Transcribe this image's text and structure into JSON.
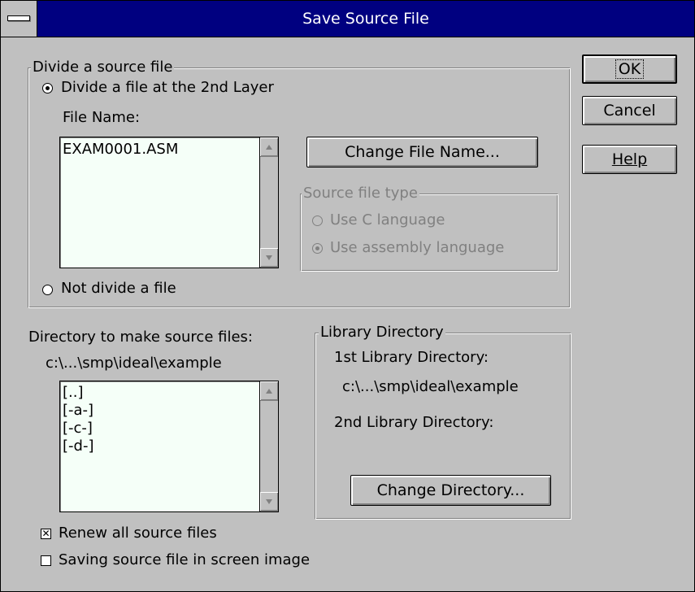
{
  "window": {
    "title": "Save Source File"
  },
  "buttons": {
    "ok": "OK",
    "cancel": "Cancel",
    "help": "Help",
    "change_file_name": "Change File Name...",
    "change_directory": "Change Directory..."
  },
  "divide_group": {
    "legend": "Divide a source file",
    "divide_radio_label": "Divide a file at the 2nd Layer",
    "divide_radio_selected": true,
    "file_name_label": "File Name:",
    "file_list": [
      "EXAM0001.ASM"
    ],
    "not_divide_label": "Not divide a file",
    "not_divide_selected": false
  },
  "source_type_group": {
    "legend": "Source file type",
    "use_c_label": "Use C language",
    "use_asm_label": "Use assembly language",
    "selected": "assembly",
    "enabled": false
  },
  "directory": {
    "label": "Directory to make source files:",
    "path": "c:\\...\\smp\\ideal\\example",
    "items": [
      "[..]",
      "[-a-]",
      "[-c-]",
      "[-d-]"
    ]
  },
  "library_group": {
    "legend": "Library Directory",
    "first_label": "1st Library Directory:",
    "first_path": "c:\\...\\smp\\ideal\\example",
    "second_label": "2nd Library Directory:",
    "second_path": ""
  },
  "options": {
    "renew_label": "Renew all source files",
    "renew_checked": true,
    "screen_image_label": "Saving source file in screen image",
    "screen_image_checked": false
  },
  "colors": {
    "title_bar": "#000080",
    "face": "#c0c0c0",
    "list_bg": "#f5fff8",
    "disabled_text": "#808080"
  }
}
